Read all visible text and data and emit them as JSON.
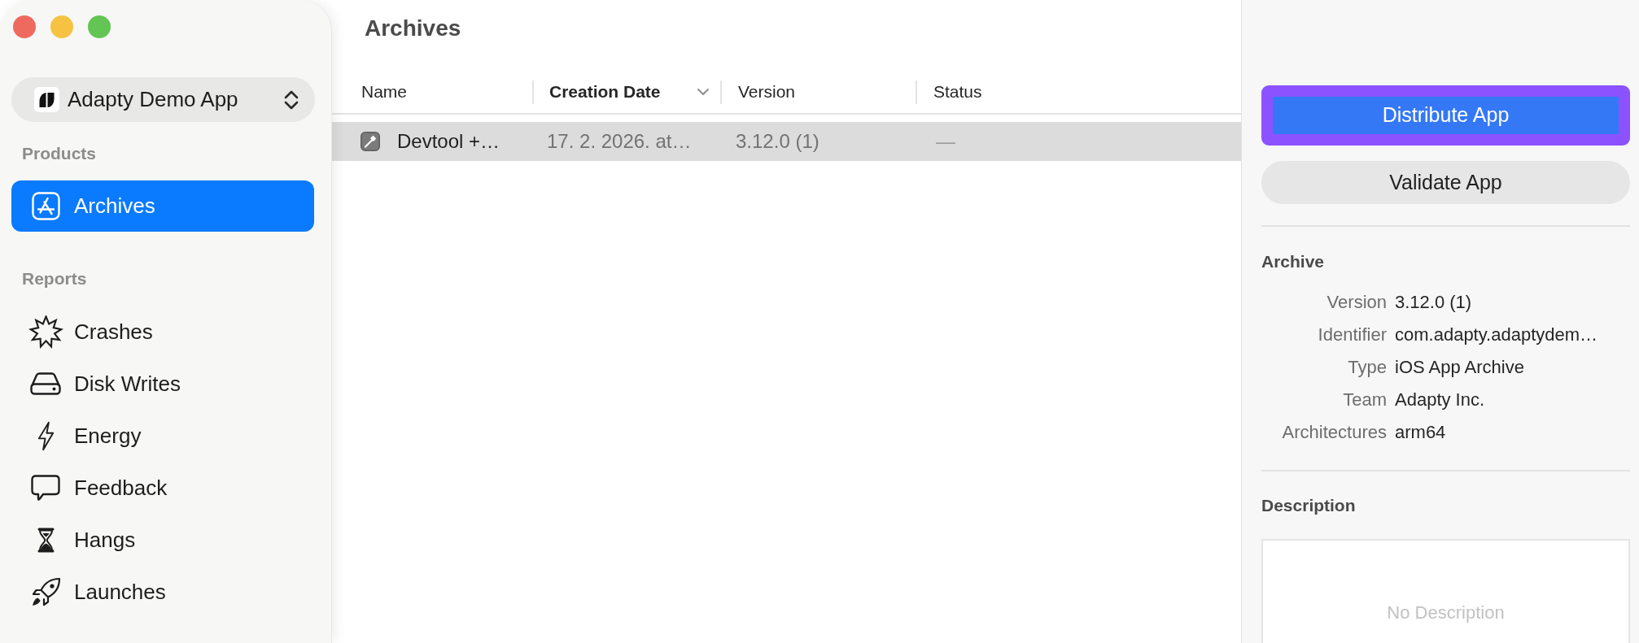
{
  "window_controls": [
    {
      "color": "#ee6a5f"
    },
    {
      "color": "#f5c341"
    },
    {
      "color": "#62c554"
    }
  ],
  "sidebar": {
    "project_selector": {
      "label": "Adapty Demo App"
    },
    "sections": [
      {
        "title": "Products",
        "items": [
          {
            "kind": "archives",
            "label": "Archives",
            "selected": true
          }
        ]
      },
      {
        "title": "Reports",
        "items": [
          {
            "kind": "crashes",
            "label": "Crashes",
            "selected": false
          },
          {
            "kind": "disk-writes",
            "label": "Disk Writes",
            "selected": false
          },
          {
            "kind": "energy",
            "label": "Energy",
            "selected": false
          },
          {
            "kind": "feedback",
            "label": "Feedback",
            "selected": false
          },
          {
            "kind": "hangs",
            "label": "Hangs",
            "selected": false
          },
          {
            "kind": "launches",
            "label": "Launches",
            "selected": false
          }
        ]
      }
    ]
  },
  "main": {
    "title": "Archives",
    "table": {
      "columns": [
        {
          "label": "Name",
          "sorted": false
        },
        {
          "label": "Creation Date",
          "sorted": true
        },
        {
          "label": "Version",
          "sorted": false
        },
        {
          "label": "Status",
          "sorted": false
        }
      ],
      "rows": [
        {
          "selected": true,
          "cells": [
            "Devtool +…",
            "17. 2. 2026. at…",
            "3.12.0 (1)",
            "—"
          ]
        }
      ]
    }
  },
  "inspector": {
    "buttons": [
      {
        "kind": "primary",
        "label": "Distribute App",
        "highlighted": true
      },
      {
        "kind": "secondary",
        "label": "Validate App",
        "highlighted": false
      }
    ],
    "archive": {
      "title": "Archive",
      "fields": [
        {
          "label": "Version",
          "value": "3.12.0 (1)"
        },
        {
          "label": "Identifier",
          "value": "com.adapty.adaptydem…"
        },
        {
          "label": "Type",
          "value": "iOS App Archive"
        },
        {
          "label": "Team",
          "value": "Adapty Inc."
        },
        {
          "label": "Architectures",
          "value": "arm64"
        }
      ]
    },
    "description": {
      "title": "Description",
      "placeholder": "No Description"
    }
  }
}
